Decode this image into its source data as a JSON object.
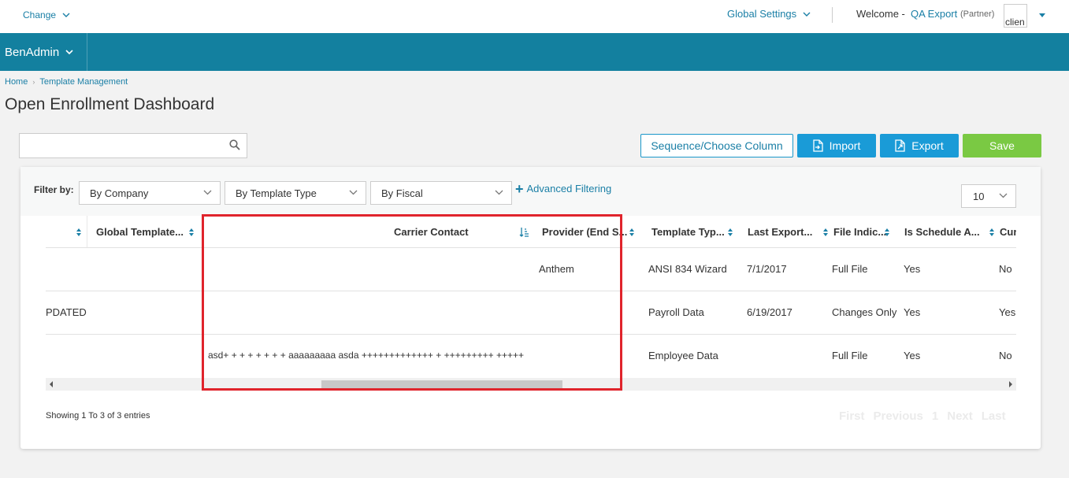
{
  "topbar": {
    "change_label": "Change",
    "global_settings": "Global Settings",
    "welcome": "Welcome -",
    "user": "QA Export",
    "role": "(Partner)",
    "client_text": "clien"
  },
  "nav": {
    "app_label": "BenAdmin"
  },
  "breadcrumb": {
    "home": "Home",
    "current": "Template Management"
  },
  "page": {
    "title": "Open Enrollment Dashboard"
  },
  "search": {
    "value": "",
    "placeholder": ""
  },
  "toolbar": {
    "sequence_label": "Sequence/Choose Column",
    "import_label": "Import",
    "export_label": "Export",
    "save_label": "Save"
  },
  "filters": {
    "label": "Filter by:",
    "company": "By Company",
    "template_type": "By Template Type",
    "fiscal": "By Fiscal",
    "advanced": "Advanced Filtering",
    "page_size": "10"
  },
  "table": {
    "columns": [
      "",
      "Global Template...",
      "Carrier Contact",
      "Provider (End S...",
      "Template Typ...",
      "Last Export...",
      "File Indic...",
      "Is Schedule A...",
      "Cur"
    ],
    "rows": [
      [
        "",
        "",
        "",
        "Anthem",
        "ANSI 834 Wizard",
        "7/1/2017",
        "Full File",
        "Yes",
        "No"
      ],
      [
        "PDATED",
        "",
        "",
        "",
        "Payroll Data",
        "6/19/2017",
        "Changes Only",
        "Yes",
        "Yes"
      ],
      [
        "",
        "",
        "asd+ + + + + + + + aaaaaaaaa asda +++++++++++++ + +++++++++ +++++",
        "",
        "Employee Data",
        "",
        "Full File",
        "Yes",
        "No"
      ]
    ]
  },
  "footer": {
    "showing": "Showing 1 To 3 of 3 entries",
    "first": "First",
    "previous": "Previous",
    "page": "1",
    "next": "Next",
    "last": "Last"
  },
  "colors": {
    "nav": "#13809f",
    "accent": "#1a9bd7",
    "save": "#7ac943",
    "highlight": "#e0242c"
  }
}
